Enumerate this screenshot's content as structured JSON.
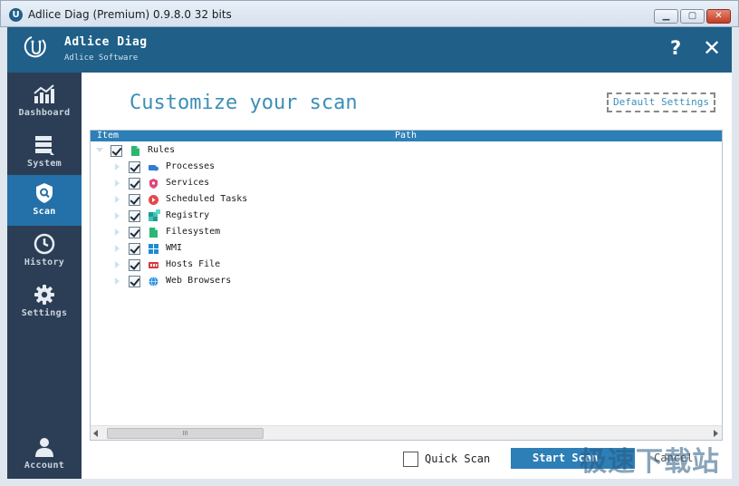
{
  "window": {
    "title": "Adlice Diag (Premium) 0.9.8.0 32 bits",
    "app_icon_letter": "U"
  },
  "header": {
    "brand": "Adlice Diag",
    "company": "Adlice Software",
    "help": "?",
    "close": "✕"
  },
  "sidebar": {
    "items": [
      {
        "label": "Dashboard",
        "icon": "chart-icon",
        "active": false
      },
      {
        "label": "System",
        "icon": "server-icon",
        "active": false
      },
      {
        "label": "Scan",
        "icon": "shield-icon",
        "active": true
      },
      {
        "label": "History",
        "icon": "clock-icon",
        "active": false
      },
      {
        "label": "Settings",
        "icon": "gear-icon",
        "active": false
      }
    ],
    "account": "Account"
  },
  "main": {
    "title": "Customize your scan",
    "default_settings": "Default Settings",
    "tree": {
      "columns": [
        "Item",
        "Path"
      ],
      "root": {
        "label": "Rules",
        "checked": true,
        "icon": "file-icon"
      },
      "children": [
        {
          "label": "Processes",
          "checked": true,
          "icon": "process-icon"
        },
        {
          "label": "Services",
          "checked": true,
          "icon": "service-icon"
        },
        {
          "label": "Scheduled Tasks",
          "checked": true,
          "icon": "task-icon"
        },
        {
          "label": "Registry",
          "checked": true,
          "icon": "registry-icon"
        },
        {
          "label": "Filesystem",
          "checked": true,
          "icon": "file-icon"
        },
        {
          "label": "WMI",
          "checked": true,
          "icon": "windows-icon"
        },
        {
          "label": "Hosts File",
          "checked": true,
          "icon": "hosts-icon"
        },
        {
          "label": "Web Browsers",
          "checked": true,
          "icon": "globe-icon"
        }
      ],
      "scroll_thumb": "III"
    },
    "quick_scan": {
      "label": "Quick Scan",
      "checked": false
    },
    "start_scan": "Start Scan",
    "cancel": "Cancel"
  },
  "watermark": "极速下载站",
  "colors": {
    "header": "#1f5f88",
    "sidebar": "#2c3e55",
    "active": "#2371a8",
    "accent": "#2d7fb7"
  }
}
